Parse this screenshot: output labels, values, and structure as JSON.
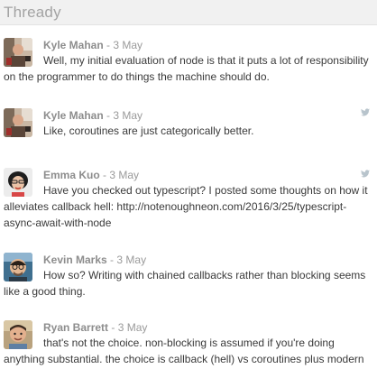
{
  "app": {
    "title": "Thready"
  },
  "posts": [
    {
      "author": "Kyle Mahan",
      "separator": "-",
      "date": "3 May",
      "text": "Well, my initial evaluation of node is that it puts a lot of responsibility on the programmer to do things the machine should do.",
      "source_icon": "twitter-icon"
    },
    {
      "author": "Kyle Mahan",
      "separator": "-",
      "date": "3 May",
      "text": "Like, coroutines are just categorically better.",
      "source_icon": "twitter-icon"
    },
    {
      "author": "Emma Kuo",
      "separator": "-",
      "date": "3 May",
      "text": "Have you checked out typescript? I posted some thoughts on how it alleviates callback hell: http://notenoughneon.com/2016/3/25/typescript-async-await-with-node"
    },
    {
      "author": "Kevin Marks",
      "separator": "-",
      "date": "3 May",
      "text": "How so? Writing with chained callbacks rather than blocking seems like a good thing."
    },
    {
      "author": "Ryan Barrett",
      "separator": "-",
      "date": "3 May",
      "text": "that's not the choice. non-blocking is assumed if you're doing anything substantial. the choice is callback (hell) vs coroutines plus modern synchronization primitives like go's channels, python's async/await, etc."
    }
  ],
  "colors": {
    "header_bg": "#f1f1f1",
    "title": "#a3a3a3",
    "author": "#8d8d8d",
    "body": "#3a3a3a",
    "icon": "#b8c4cc"
  }
}
